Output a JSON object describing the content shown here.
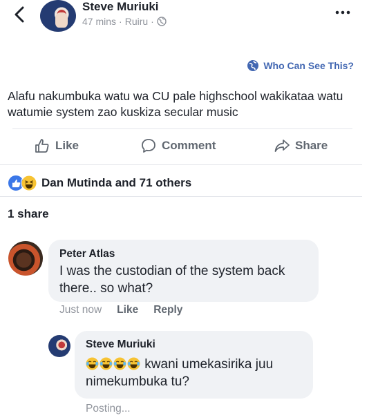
{
  "header": {
    "author": "Steve Muriuki",
    "time": "47 mins",
    "separator": "·",
    "location": "Ruiru",
    "more_icon": "more-horizontal-icon",
    "back_icon": "chevron-left-icon"
  },
  "privacy": {
    "label": "Who Can See This?"
  },
  "post": {
    "text": "Alafu nakumbuka watu wa CU pale highschool wakikataa watu watumie system zao kuskiza secular music"
  },
  "actions": {
    "like": "Like",
    "comment": "Comment",
    "share": "Share"
  },
  "reactions": {
    "summary": "Dan Mutinda and 71 others",
    "types": [
      "like",
      "haha"
    ]
  },
  "shares": {
    "label": "1 share"
  },
  "comments": [
    {
      "author": "Peter Atlas",
      "text": "I was the custodian of the system back there.. so what?",
      "time": "Just now",
      "like": "Like",
      "reply": "Reply"
    },
    {
      "author": "Steve Muriuki",
      "emoji_count": 4,
      "text": "kwani umekasirika juu nimekumbuka tu?",
      "status": "Posting..."
    }
  ],
  "colors": {
    "accent": "#4267b2",
    "like_blue": "#3b77e8",
    "muted": "#90949c",
    "bubble": "#f0f2f5"
  }
}
